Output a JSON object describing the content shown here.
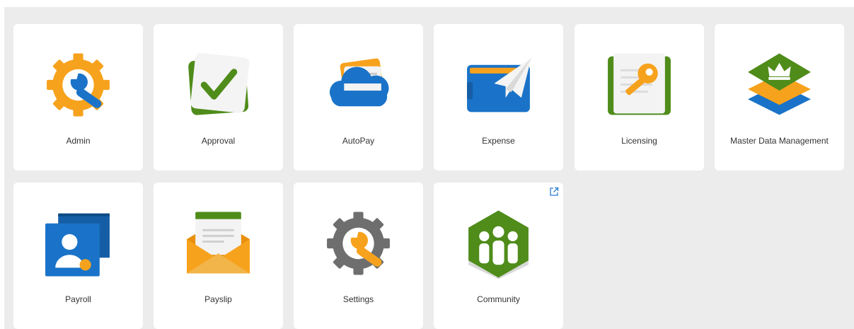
{
  "tiles": [
    {
      "label": "Admin",
      "icon": "admin-gear-wrench-icon"
    },
    {
      "label": "Approval",
      "icon": "approval-checkmark-icon"
    },
    {
      "label": "AutoPay",
      "icon": "autopay-cloud-card-icon"
    },
    {
      "label": "Expense",
      "icon": "expense-wallet-plane-icon"
    },
    {
      "label": "Licensing",
      "icon": "licensing-key-icon"
    },
    {
      "label": "Master Data Management",
      "icon": "master-data-stack-crown-icon"
    },
    {
      "label": "Payroll",
      "icon": "payroll-person-card-icon"
    },
    {
      "label": "Payslip",
      "icon": "payslip-envelope-icon"
    },
    {
      "label": "Settings",
      "icon": "settings-gear-wrench-icon"
    },
    {
      "label": "Community",
      "icon": "community-people-icon",
      "external": true
    }
  ],
  "colors": {
    "background": "#ececec",
    "tile": "#ffffff",
    "orange": "#f7a21d",
    "green": "#4f8c1a",
    "blue": "#1a73c8",
    "gray": "#6e6e6e",
    "link": "#2b7bd6"
  }
}
